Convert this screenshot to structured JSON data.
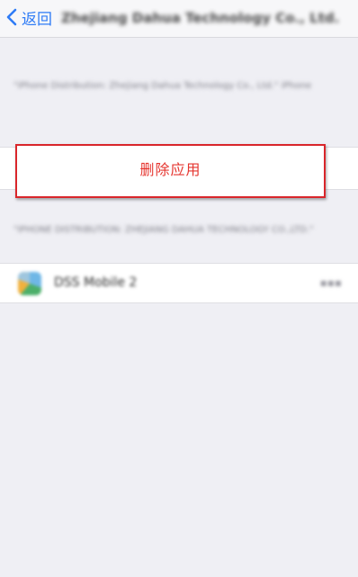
{
  "nav": {
    "back_label": "返回",
    "title": "Zhejiang Dahua Technology Co., Ltd."
  },
  "notes": {
    "top": "\"iPhone Distribution: Zhejiang Dahua Technology Co., Ltd.\" iPhone",
    "bottom": "\"IPHONE DISTRIBUTION: ZHEJIANG DAHUA TECHNOLOGY CO.,LTD.\""
  },
  "delete_app": {
    "label": "删除应用",
    "color": "#e5352f",
    "highlight_color": "#d9262b"
  },
  "app": {
    "name": "DSS Mobile 2",
    "icon": "app-icon"
  },
  "colors": {
    "accent": "#2f7cf6",
    "background": "#efeff4"
  }
}
